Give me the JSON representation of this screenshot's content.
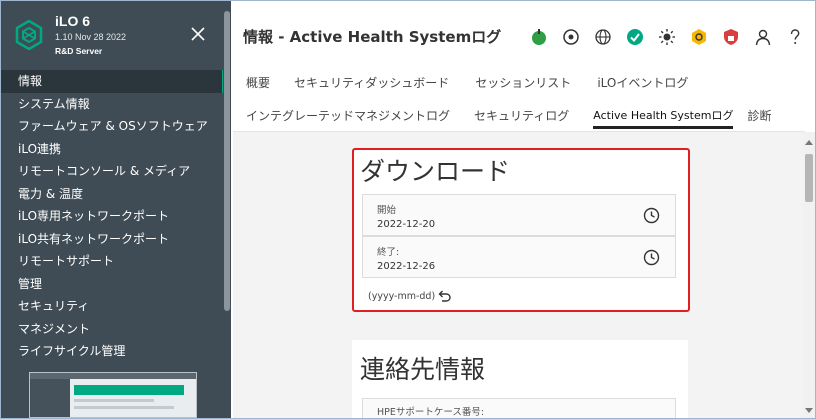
{
  "app": {
    "name": "iLO 6",
    "version": "1.10 Nov 28 2022",
    "server": "R&D Server"
  },
  "sidebar": {
    "items": [
      {
        "label": "情報",
        "active": true
      },
      {
        "label": "システム情報"
      },
      {
        "label": "ファームウェア & OSソフトウェア"
      },
      {
        "label": "iLO連携"
      },
      {
        "label": "リモートコンソール & メディア"
      },
      {
        "label": "電力 & 温度"
      },
      {
        "label": "iLO専用ネットワークポート"
      },
      {
        "label": "iLO共有ネットワークポート"
      },
      {
        "label": "リモートサポート"
      },
      {
        "label": "管理"
      },
      {
        "label": "セキュリティ"
      },
      {
        "label": "マネジメント"
      },
      {
        "label": "ライフサイクル管理"
      }
    ]
  },
  "header": {
    "title": "情報 - Active Health Systemログ",
    "icons": [
      "power-icon",
      "location-icon",
      "globe-icon",
      "health-ok-icon",
      "brightness-icon",
      "hexagon-alert-icon",
      "shield-icon",
      "user-icon",
      "help-icon"
    ]
  },
  "tabs": {
    "row1": [
      "概要",
      "セキュリティダッシュボード",
      "セッションリスト",
      "iLOイベントログ"
    ],
    "row2": [
      "インテグレーテッドマネジメントログ",
      "セキュリティログ",
      "Active Health Systemログ",
      "診断"
    ],
    "active": "Active Health Systemログ"
  },
  "download": {
    "title": "ダウンロード",
    "start_label": "開始",
    "start_value": "2022-12-20",
    "end_label": "終了:",
    "end_value": "2022-12-26",
    "format_hint": "(yyyy-mm-dd)"
  },
  "contact": {
    "title": "連絡先情報",
    "case_label": "HPEサポートケース番号:"
  },
  "colors": {
    "sidebar_bg": "#3f4c55",
    "accent_green": "#01a982",
    "highlight_red": "#e02020"
  }
}
